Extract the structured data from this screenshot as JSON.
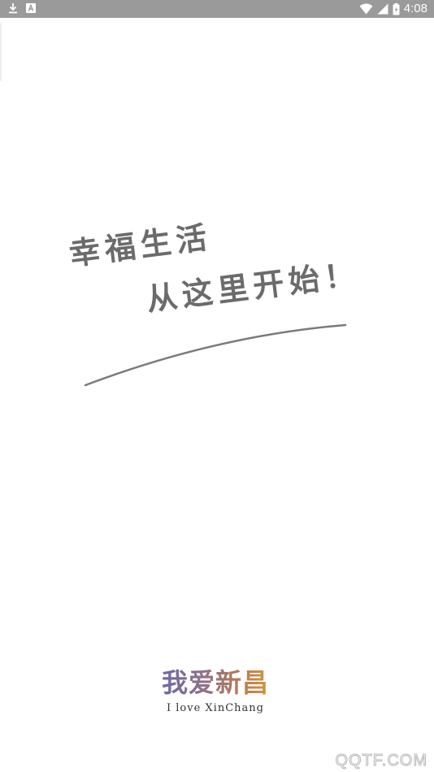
{
  "status_bar": {
    "time": "4:08",
    "left_icons": [
      "download-icon",
      "keyboard-a-icon"
    ],
    "right_icons": [
      "wifi-icon",
      "signal-icon",
      "battery-icon"
    ],
    "background_color": "#9a9a9a"
  },
  "splash": {
    "slogan_line_1": "幸福生活",
    "slogan_line_2": "从这里开始！",
    "text_color": "#6b6b6b"
  },
  "logo": {
    "chinese_name": "我爱新昌",
    "english_name": "I love XinChang",
    "gradient_colors": [
      "#6a6aa8",
      "#8a6f8e",
      "#b07a5a",
      "#d49a3a"
    ]
  },
  "watermark": {
    "text": "QQTF.COM"
  }
}
